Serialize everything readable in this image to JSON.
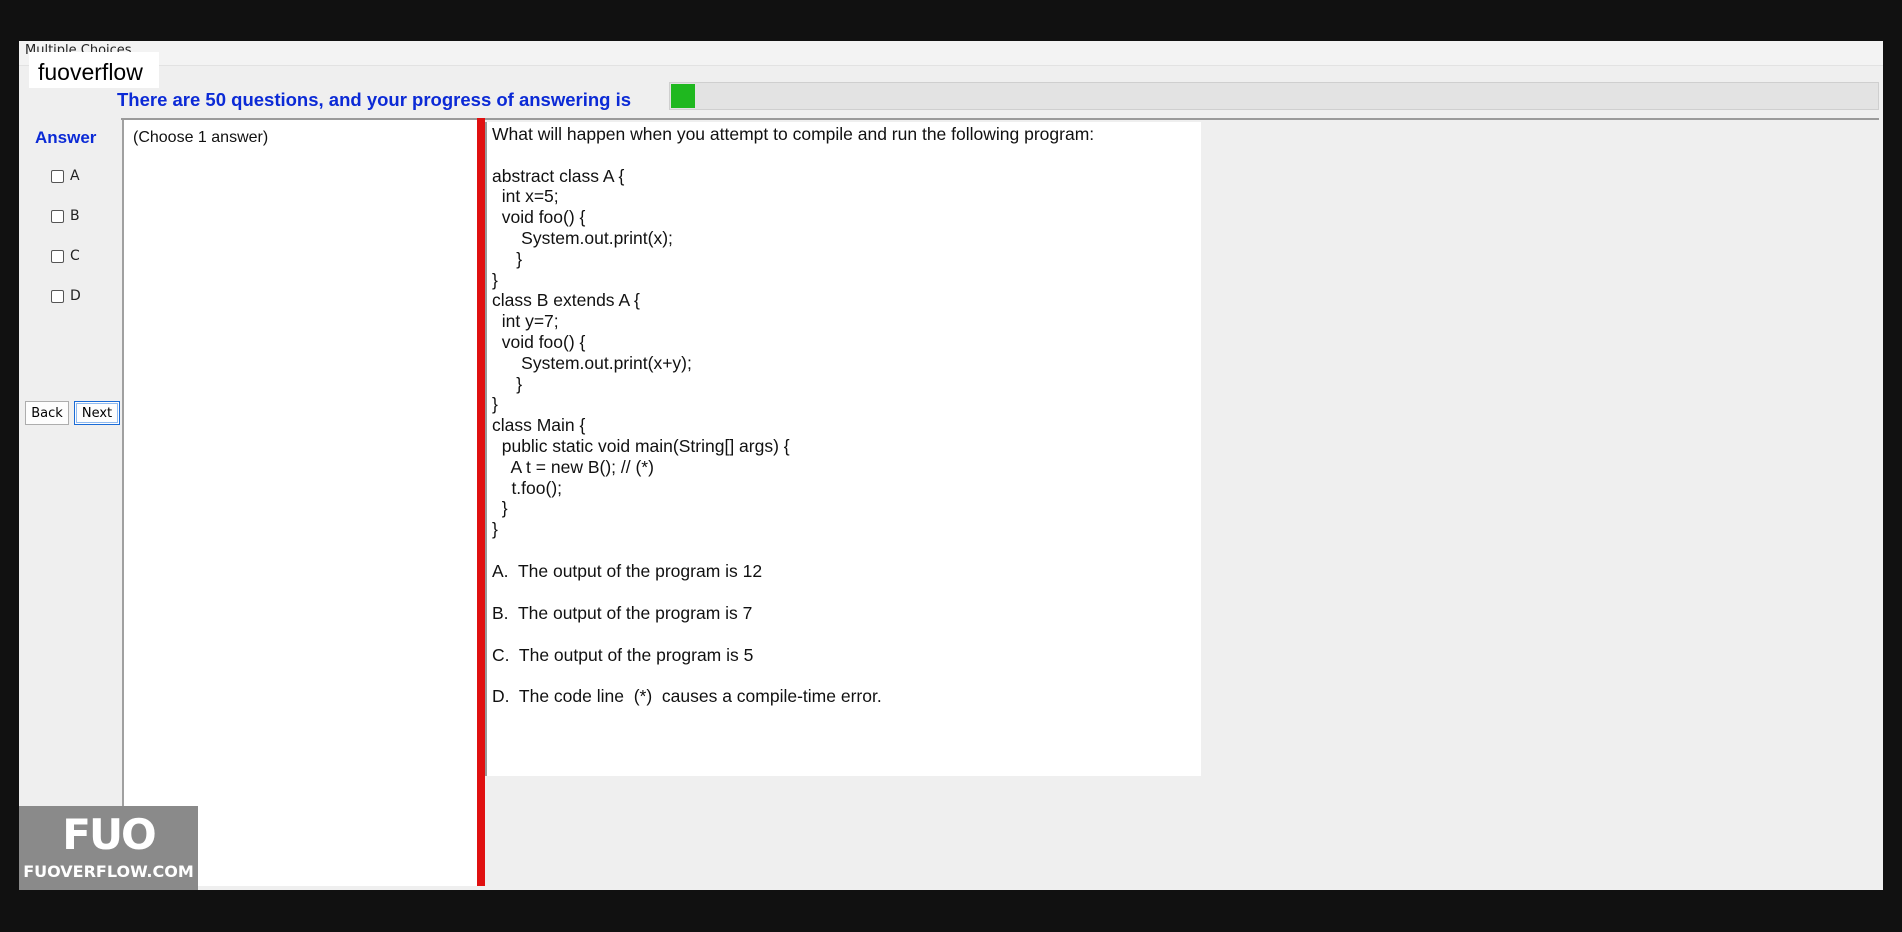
{
  "window": {
    "title": "Multiple Choices"
  },
  "brand": {
    "name": "fuoverflow"
  },
  "progress": {
    "label": "There are 50 questions, and your progress of answering is",
    "fraction": 0.02,
    "fill_color": "#1fb81f"
  },
  "answer": {
    "title": "Answer",
    "options": [
      "A",
      "B",
      "C",
      "D"
    ],
    "hint": "(Choose 1 answer)"
  },
  "nav": {
    "back_label": "Back",
    "next_label": "Next"
  },
  "question": {
    "text": "What will happen when you attempt to compile and run the following program:\n\nabstract class A {\n  int x=5;\n  void foo() {\n      System.out.print(x);\n     }\n}\nclass B extends A {\n  int y=7;\n  void foo() {\n      System.out.print(x+y);\n     }\n}\nclass Main {\n  public static void main(String[] args) {\n    A t = new B(); // (*)\n    t.foo();\n  }\n}",
    "choices": [
      "A.  The output of the program is 12",
      "B.  The output of the program is 7",
      "C.  The output of the program is 5",
      "D.  The code line  (*)  causes a compile-time error."
    ]
  },
  "watermark": {
    "mark": "FUO",
    "caption": "FUOVERFLOW.COM"
  },
  "colors": {
    "accent_blue": "#0b2ad6",
    "separator_red": "#e01010"
  }
}
